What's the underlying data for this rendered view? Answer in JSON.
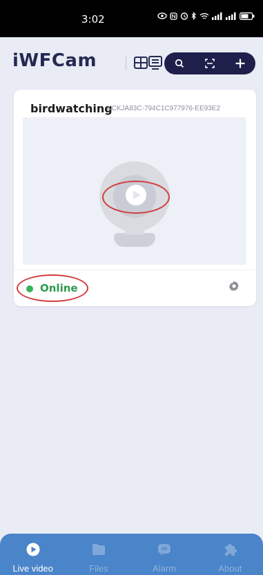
{
  "status_bar": {
    "time": "3:02"
  },
  "header": {
    "app_title": "iWFCam",
    "icons": [
      "grid-view-icon",
      "list-view-icon",
      "search-icon",
      "scan-icon",
      "add-icon"
    ]
  },
  "camera": {
    "name": "birdwatching",
    "device_id": "KCKJA83C-794C1C977976-EE93E2",
    "status": "Online",
    "status_color": "#34b35a"
  },
  "bottom_nav": {
    "items": [
      {
        "label": "Live video",
        "icon": "play-circle-icon",
        "active": true
      },
      {
        "label": "Files",
        "icon": "folder-icon",
        "active": false
      },
      {
        "label": "Alarm",
        "icon": "alarm-chat-icon",
        "active": false
      },
      {
        "label": "About",
        "icon": "puzzle-icon",
        "active": false
      }
    ]
  },
  "colors": {
    "background": "#e9ebf5",
    "title": "#242a52",
    "action_pill": "#1e1f4a",
    "nav_bar": "#4a84c9",
    "annotation_ring": "#d23a3a"
  }
}
